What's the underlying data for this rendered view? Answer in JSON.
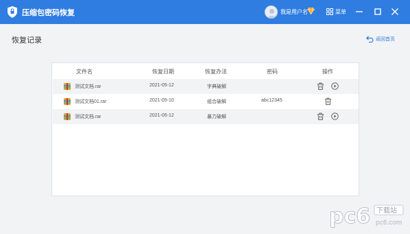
{
  "app": {
    "title": "压缩包密码恢复"
  },
  "user": {
    "name": "我是用户名"
  },
  "header": {
    "menu_label": "菜单"
  },
  "page": {
    "heading": "恢复记录",
    "back_label": "返回首页"
  },
  "table": {
    "columns": [
      "文件名",
      "恢复日期",
      "恢复办法",
      "密码",
      "操作"
    ],
    "rows": [
      {
        "file": "测试文档.rar",
        "date": "2021-05-12",
        "method": "字典破解",
        "password": ""
      },
      {
        "file": "测试文档01.rar",
        "date": "2021-05-10",
        "method": "组合破解",
        "password": "abc12345"
      },
      {
        "file": "测试文档.rar",
        "date": "2021-05-12",
        "method": "暴力破解",
        "password": ""
      }
    ]
  },
  "watermark": {
    "text": "pc6",
    "sub": "下载站",
    "site": "pc6.com"
  },
  "colors": {
    "accent": "#2f7de1",
    "row_alt": "#f2f3f5",
    "background": "#f2f3f5"
  }
}
